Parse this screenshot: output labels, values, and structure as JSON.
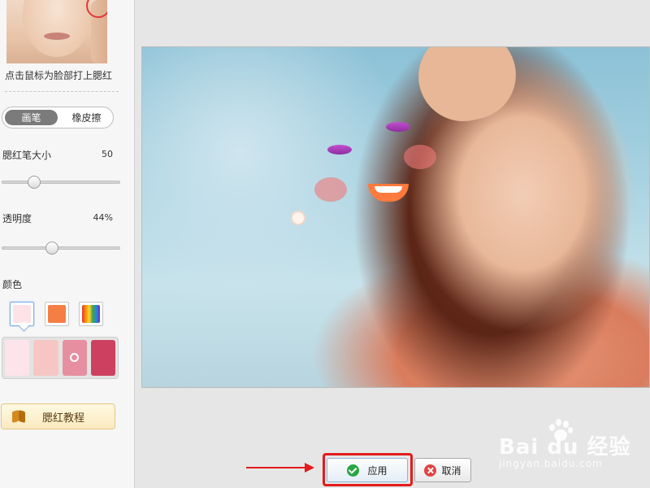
{
  "sidebar": {
    "hint": "点击鼠标为脸部打上腮红",
    "mode_tabs": [
      {
        "label": "画笔",
        "active": true
      },
      {
        "label": "橡皮擦",
        "active": false
      }
    ],
    "brush_size": {
      "label": "腮红笔大小",
      "value": "50",
      "level": 0.27
    },
    "opacity": {
      "label": "透明度",
      "value": "44%",
      "level": 0.42
    },
    "color_label": "颜色",
    "color_swatches": [
      {
        "name": "light-pink",
        "color": "#fde2e8",
        "selected": true
      },
      {
        "name": "orange",
        "color": "#f47e44",
        "selected": false
      },
      {
        "name": "rainbow-picker",
        "color": "rainbow",
        "selected": false
      }
    ],
    "presets": [
      {
        "color": "#fde4ea",
        "selected": false
      },
      {
        "color": "#f6c6c4",
        "selected": false
      },
      {
        "color": "#e68fa0",
        "selected": true
      },
      {
        "color": "#cd4160",
        "selected": false
      }
    ],
    "tutorial_button": "腮红教程"
  },
  "footer": {
    "apply_label": "应用",
    "cancel_label": "取消"
  },
  "watermark": {
    "brand": "Bai du 经验",
    "sub": "jingyan.baidu.com"
  },
  "colors": {
    "annotation_red": "#e21c1c",
    "apply_check": "#2aa544",
    "cancel_x": "#e04343"
  }
}
